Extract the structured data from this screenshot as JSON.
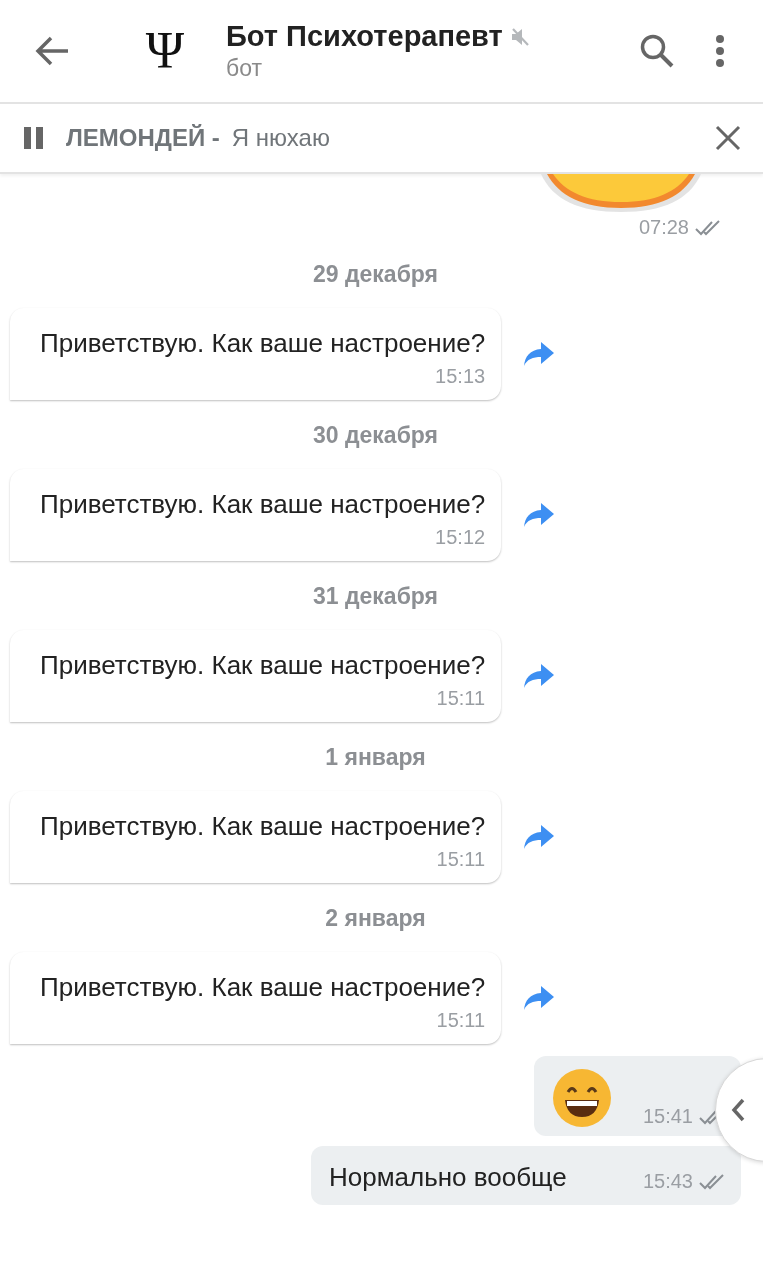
{
  "header": {
    "avatar": "Ψ",
    "title": "Бот Психотерапевт",
    "muted": true,
    "subtitle": "бот"
  },
  "player": {
    "playing": true,
    "artist": "ЛЕМОНДЕЙ -",
    "track": "Я нюхаю"
  },
  "messages": [
    {
      "kind": "sticker",
      "time": "07:28",
      "read": true
    },
    {
      "kind": "date",
      "text": "29 декабря"
    },
    {
      "kind": "incoming",
      "text": "Приветствую. Как ваше настроение?",
      "time": "15:13"
    },
    {
      "kind": "date",
      "text": "30 декабря"
    },
    {
      "kind": "incoming",
      "text": "Приветствую. Как ваше настроение?",
      "time": "15:12"
    },
    {
      "kind": "date",
      "text": "31 декабря"
    },
    {
      "kind": "incoming",
      "text": "Приветствую. Как ваше настроение?",
      "time": "15:11"
    },
    {
      "kind": "date",
      "text": "1 января"
    },
    {
      "kind": "incoming",
      "text": "Приветствую. Как ваше настроение?",
      "time": "15:11"
    },
    {
      "kind": "date",
      "text": "2 января"
    },
    {
      "kind": "incoming",
      "text": "Приветствую. Как ваше настроение?",
      "time": "15:11"
    },
    {
      "kind": "emoji",
      "time": "15:41",
      "read": true
    },
    {
      "kind": "outgoing",
      "text": "Нормально вообще",
      "time": "15:43",
      "read": true
    }
  ]
}
